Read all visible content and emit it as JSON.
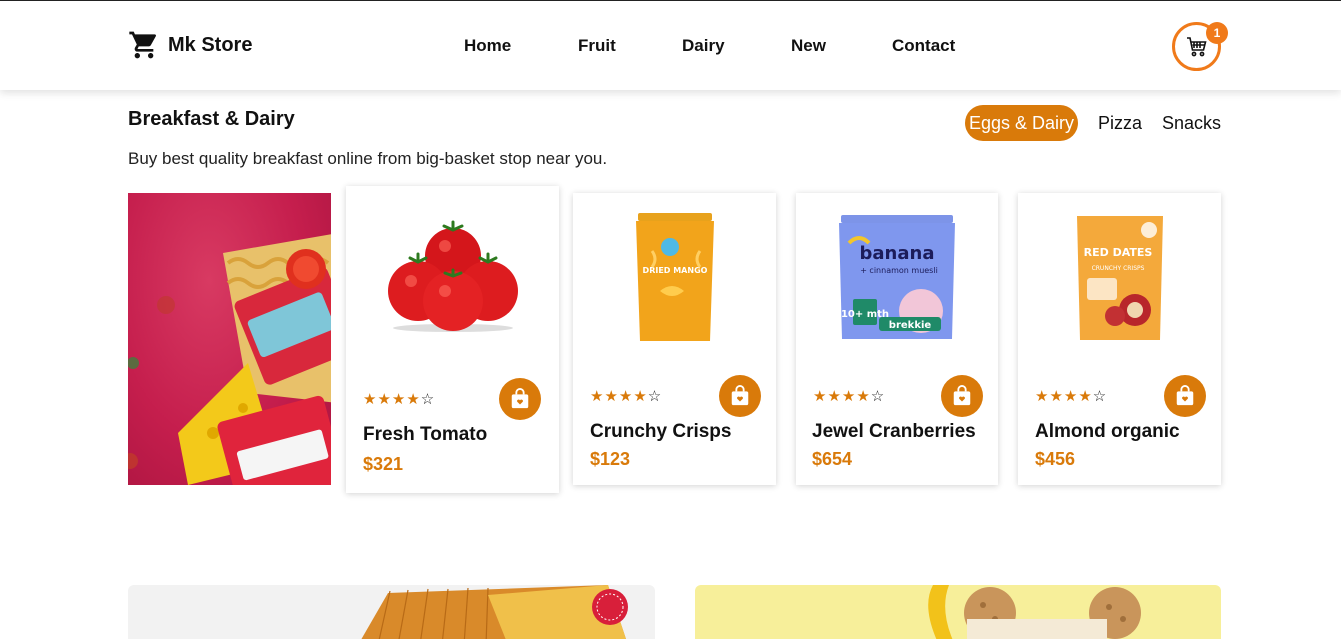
{
  "brand": {
    "name": "Mk Store",
    "icon": "cart-icon"
  },
  "nav": {
    "items": [
      "Home",
      "Fruit",
      "Dairy",
      "New",
      "Contact"
    ]
  },
  "cart": {
    "count": "1",
    "icon": "shopping-cart-icon"
  },
  "section": {
    "title": "Breakfast & Dairy",
    "subtitle": "Buy best quality breakfast online from big-basket stop near you."
  },
  "tabs": {
    "items": [
      "Eggs & Dairy",
      "Pizza",
      "Snacks"
    ],
    "active": "Eggs & Dairy"
  },
  "colors": {
    "accent": "#d97a0a",
    "cart_ring": "#f07a1a",
    "promo_bg": "#c51e4d"
  },
  "products": [
    {
      "name": "Fresh Tomato",
      "price": "$321",
      "rating": 4,
      "max_rating": 5,
      "image": "tomatoes"
    },
    {
      "name": "Crunchy Crisps",
      "price": "$123",
      "rating": 4,
      "max_rating": 5,
      "image": "dried-mango-pouch"
    },
    {
      "name": "Jewel Cranberries",
      "price": "$654",
      "rating": 4,
      "max_rating": 5,
      "image": "banana-muesli-pouch"
    },
    {
      "name": "Almond organic",
      "price": "$456",
      "rating": 4,
      "max_rating": 5,
      "image": "red-dates-pouch"
    }
  ],
  "packaging_text": {
    "mango": "DRIED MANGO",
    "banana_top": "banana",
    "banana_mid": "+ cinnamon muesli",
    "banana_badge": "10+ mth",
    "banana_brand": "brekkie",
    "dates": "RED DATES",
    "dates_sub": "CRUNCHY CRISPS"
  }
}
